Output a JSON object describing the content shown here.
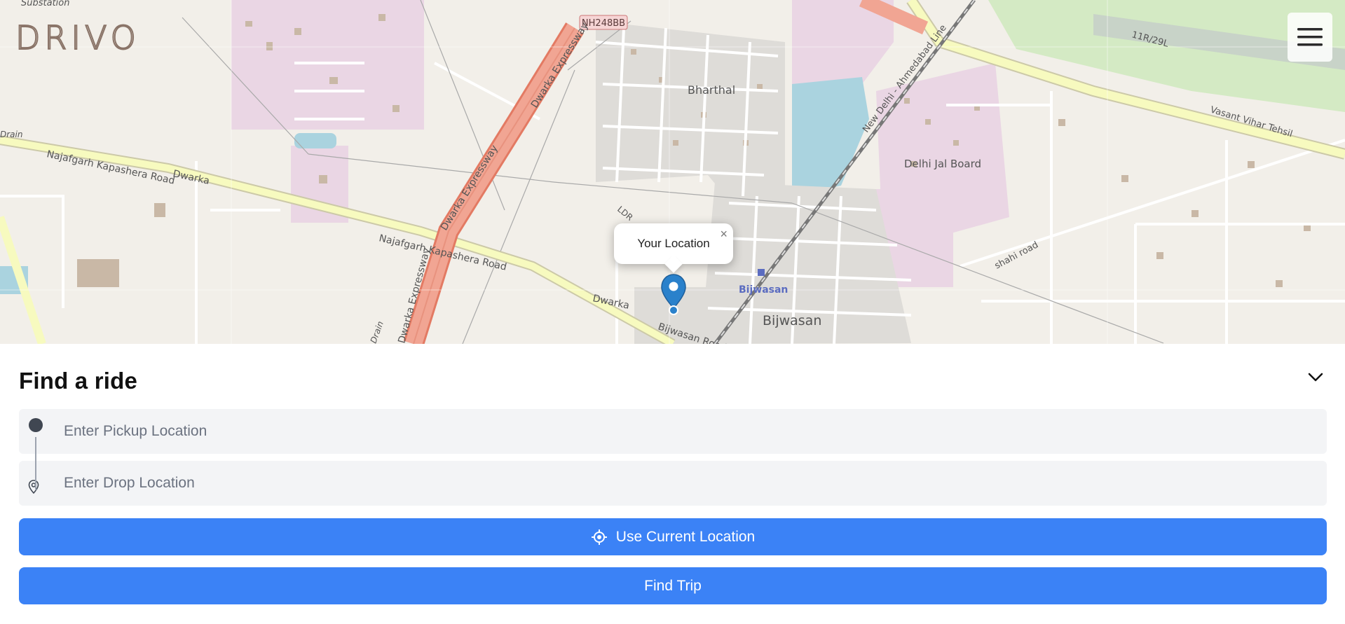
{
  "app": {
    "logo_text": "DRIVO"
  },
  "map": {
    "labels": {
      "substation": "Substation",
      "nh248bb": "NH248BB",
      "dwarka_expressway": "Dwarka Expressway",
      "bharthal": "Bharthal",
      "new_delhi_line": "New Delhi - Ahmedabad Line",
      "runway": "11R/29L",
      "vasant_vihar": "Vasant Vihar Tehsil",
      "najafgarh_road": "Najafgarh Kapashera Road",
      "dwarka": "Dwarka",
      "drain": "Drain",
      "delhi_jal_board": "Delhi Jal Board",
      "shahi_road": "shahi road",
      "bijwasan": "Bijwasan",
      "bijwasan_station": "Bijwasan",
      "bijwasan_road": "Bijwasan Road",
      "ldr": "LDR",
      "drain2": "Drain"
    },
    "popup": {
      "text": "Your Location",
      "close_symbol": "×"
    }
  },
  "panel": {
    "title": "Find a ride",
    "pickup": {
      "placeholder": "Enter Pickup Location",
      "value": ""
    },
    "drop": {
      "placeholder": "Enter Drop Location",
      "value": ""
    },
    "use_location_label": "Use Current Location",
    "find_trip_label": "Find Trip"
  },
  "colors": {
    "accent": "#3b82f6",
    "marker": "#2a81cb"
  }
}
